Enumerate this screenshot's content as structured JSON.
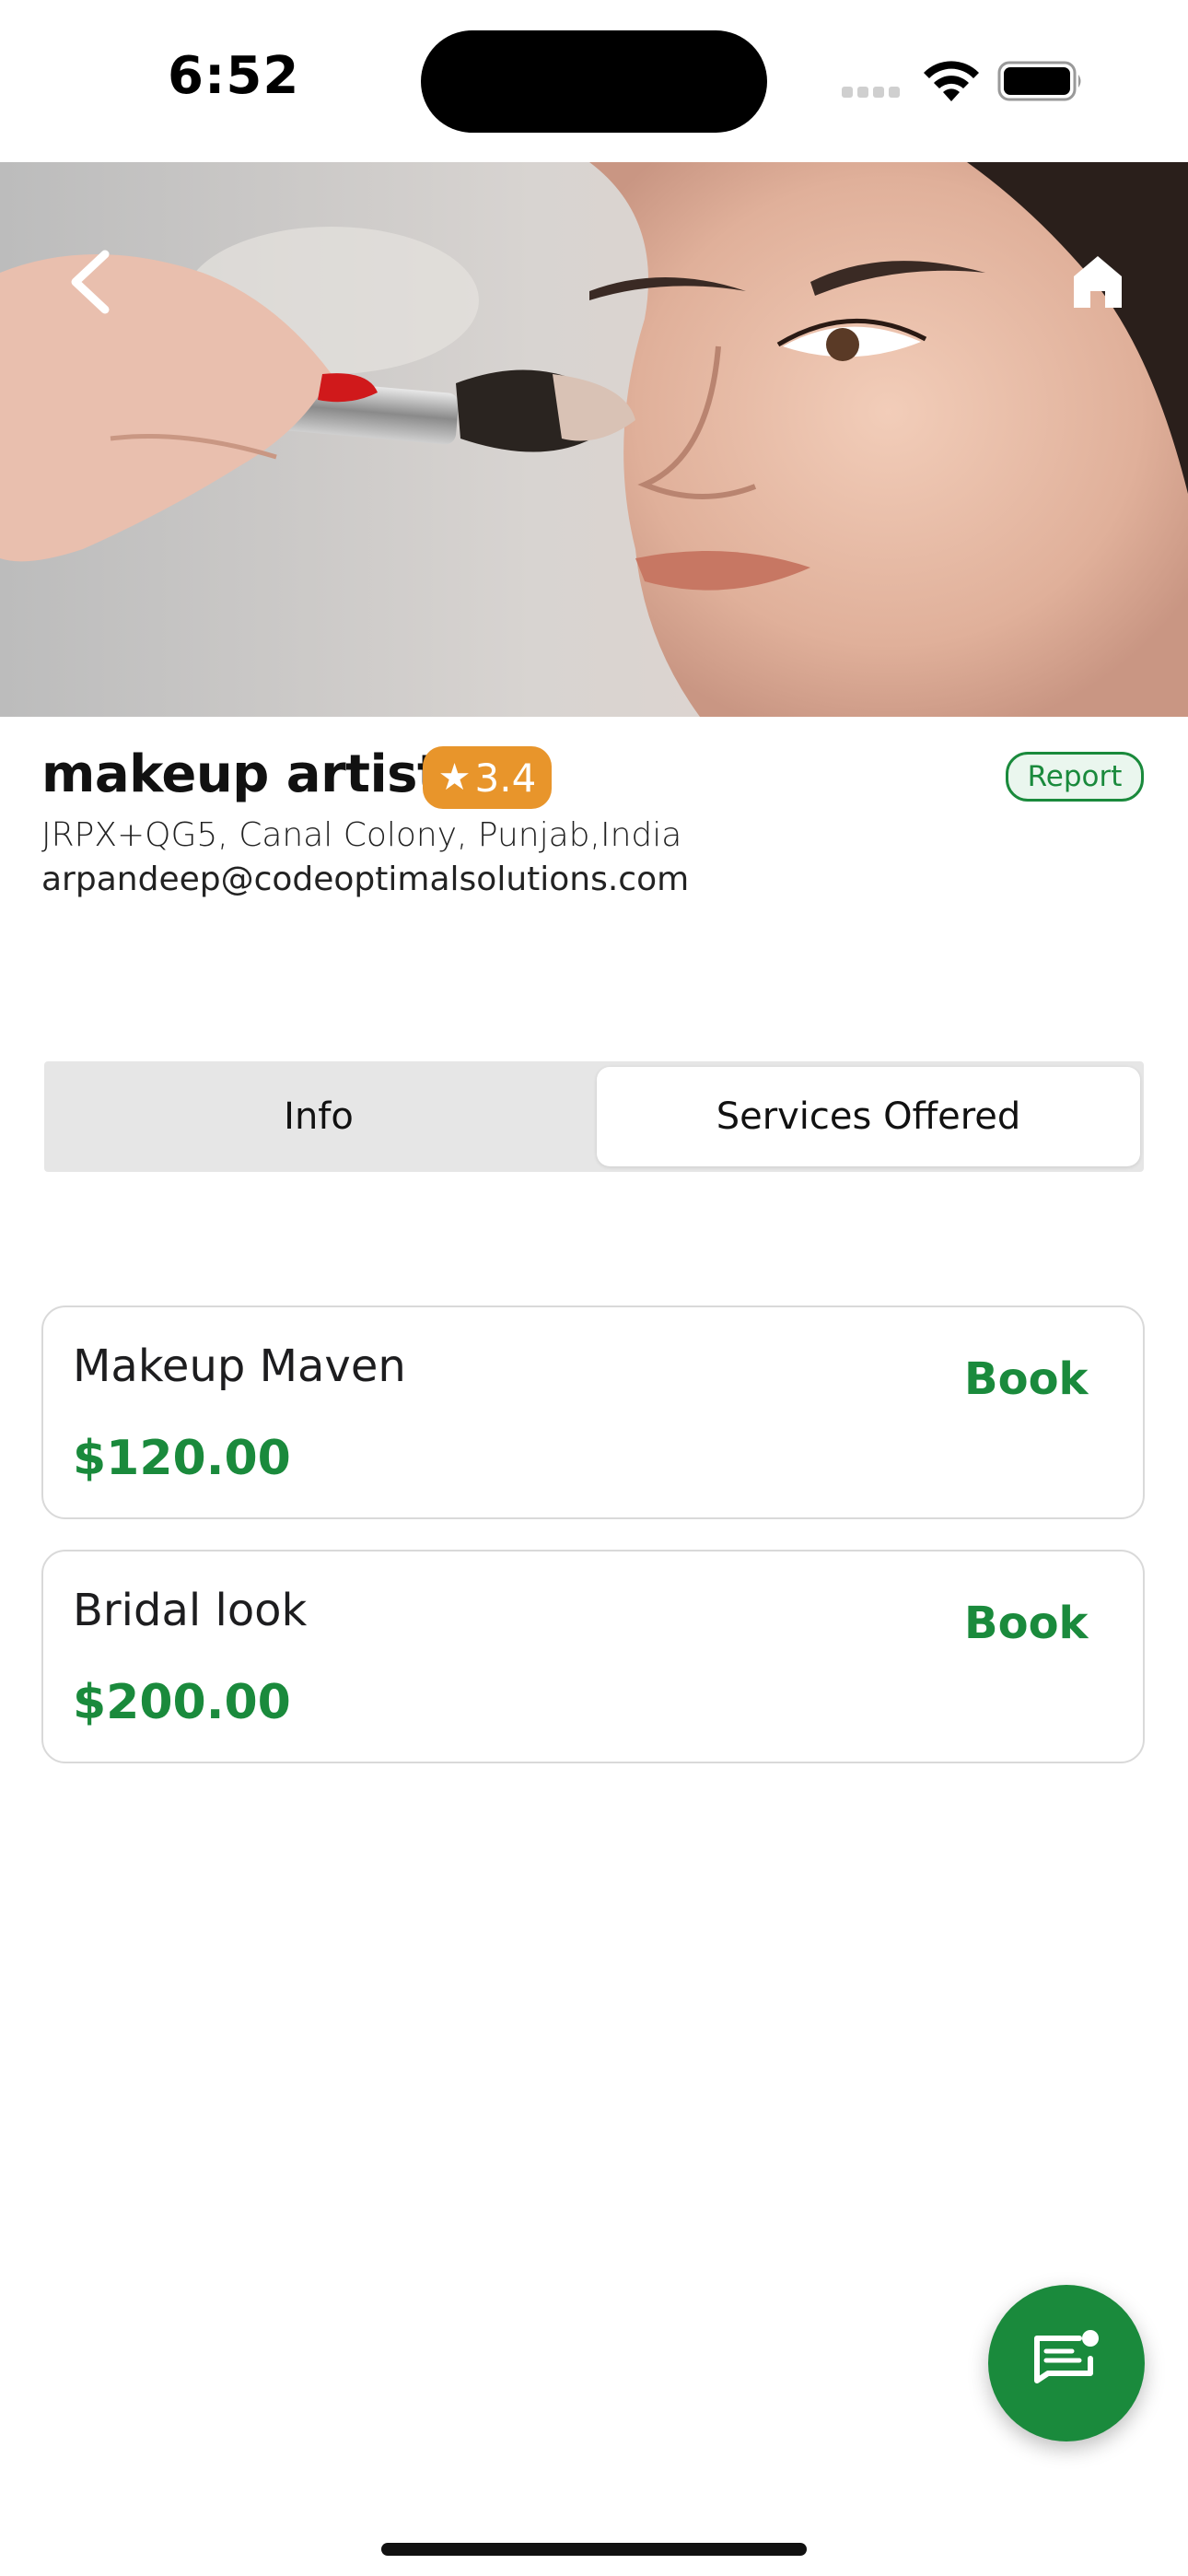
{
  "status_bar": {
    "time": "6:52"
  },
  "hero": {
    "image_description_icon": "makeup-brush-photo",
    "back_icon": "chevron-left-icon",
    "home_icon": "home-icon"
  },
  "profile": {
    "title": "makeup artist",
    "rating": "3.4",
    "rating_icon": "star-icon",
    "report_label": "Report",
    "address": "JRPX+QG5, Canal Colony, Punjab,India",
    "email": "arpandeep@codeoptimalsolutions.com"
  },
  "tabs": [
    {
      "label": "Info",
      "selected": false
    },
    {
      "label": "Services Offered",
      "selected": true
    }
  ],
  "services": [
    {
      "name": "Makeup Maven",
      "price": "$120.00",
      "action": "Book"
    },
    {
      "name": "Bridal look",
      "price": "$200.00",
      "action": "Book"
    }
  ],
  "fab": {
    "icon": "chat-icon"
  },
  "colors": {
    "accent_green": "#1a8a3c",
    "rating_orange": "#e8952b",
    "segment_bg": "#e6e6e6"
  }
}
